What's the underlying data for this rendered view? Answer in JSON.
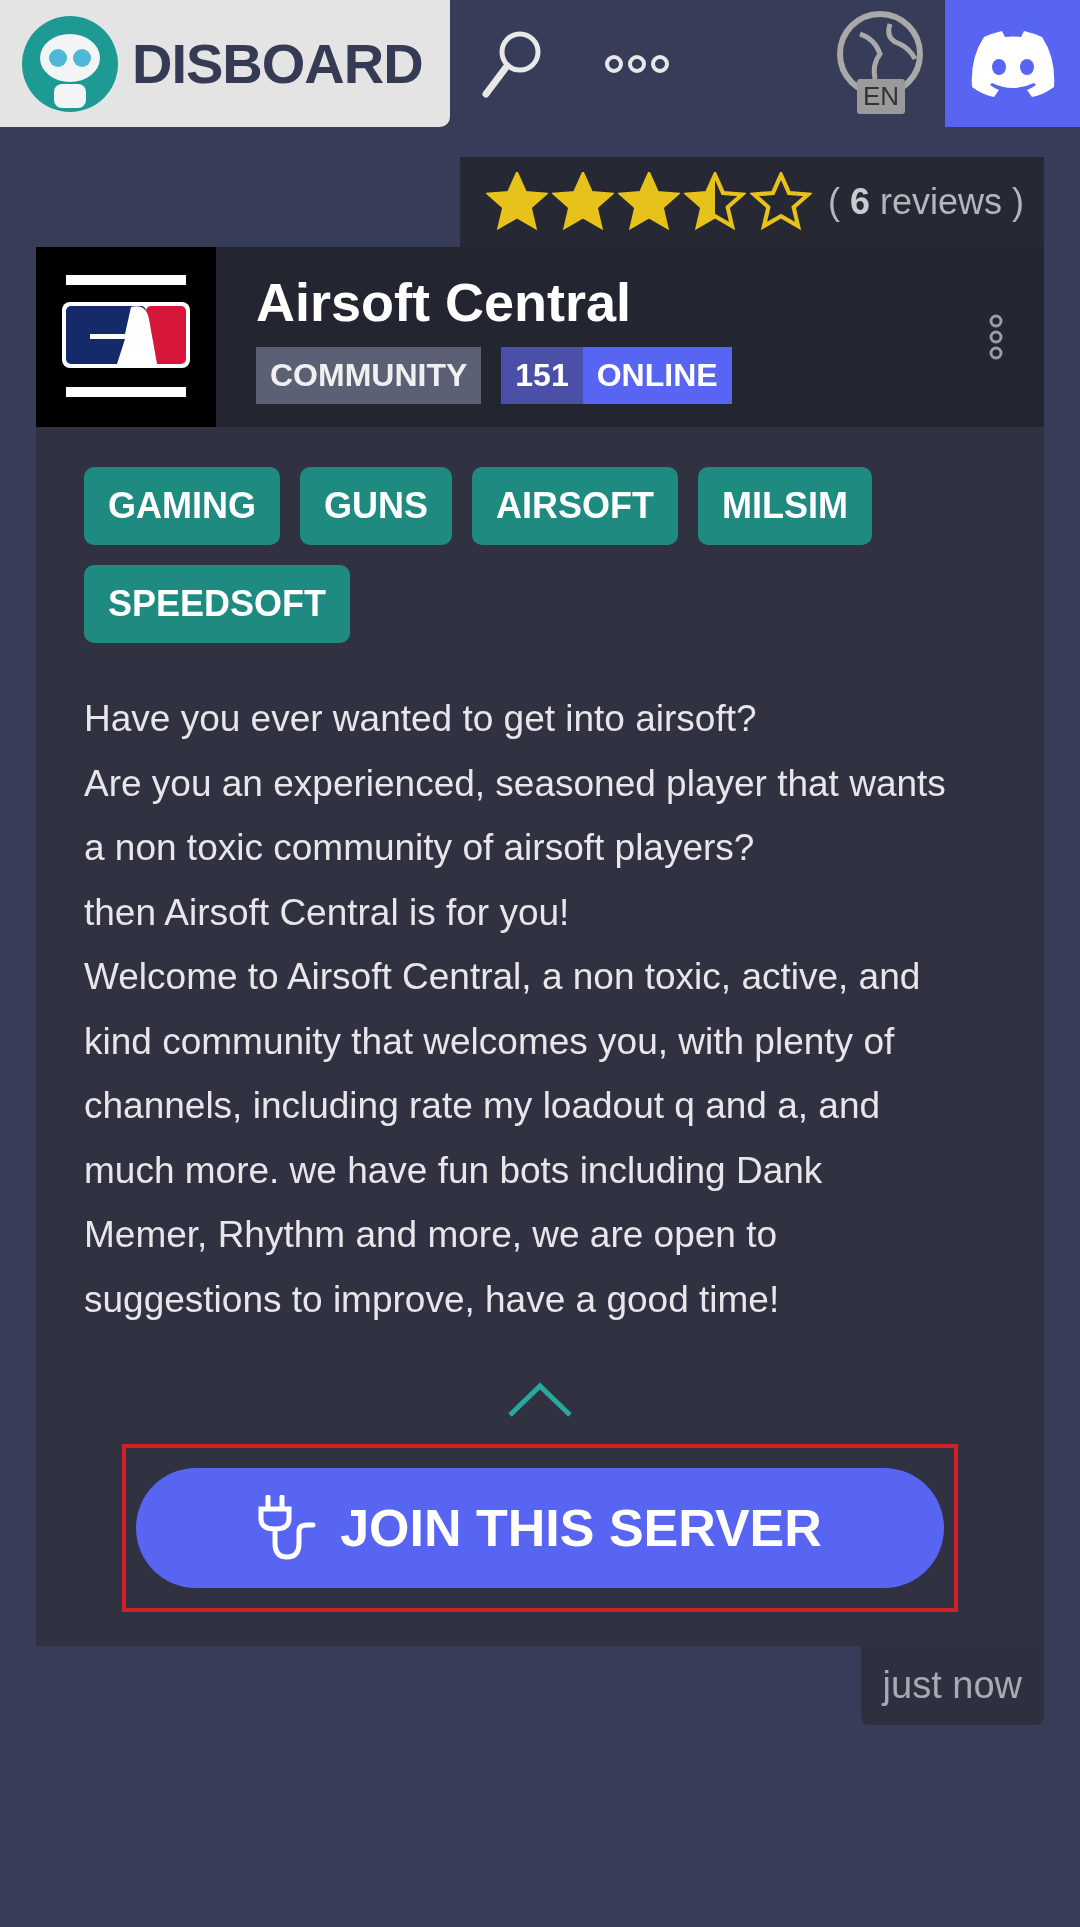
{
  "header": {
    "logo_text": "DISBOARD",
    "language": "EN"
  },
  "server": {
    "stars": 3.5,
    "reviews": "( **6** reviews )",
    "logo": {
      "kind": "picture"
    },
    "name": "Airsoft Central",
    "category": "COMMUNITY",
    "online_count": "151",
    "online_label": "ONLINE",
    "tags": [
      "GAMING",
      "GUNS",
      "AIRSOFT",
      "MILSIM",
      "SPEEDSOFT"
    ],
    "description": [
      "Have you ever wanted to get into airsoft?",
      "Are you an experienced, seasoned player that wants a non toxic community of airsoft players?",
      "then Airsoft Central is for you!",
      "Welcome to Airsoft Central, a non toxic, active, and kind community that welcomes you, with plenty of channels, including rate my loadout q and a, and much more. we have fun bots including Dank Memer, Rhythm and more, we are open to suggestions to improve, have a good time!"
    ],
    "expanded": true,
    "join_button": {
      "label": "JOIN THIS SERVER",
      "highlighted": true
    },
    "time": "just now"
  }
}
